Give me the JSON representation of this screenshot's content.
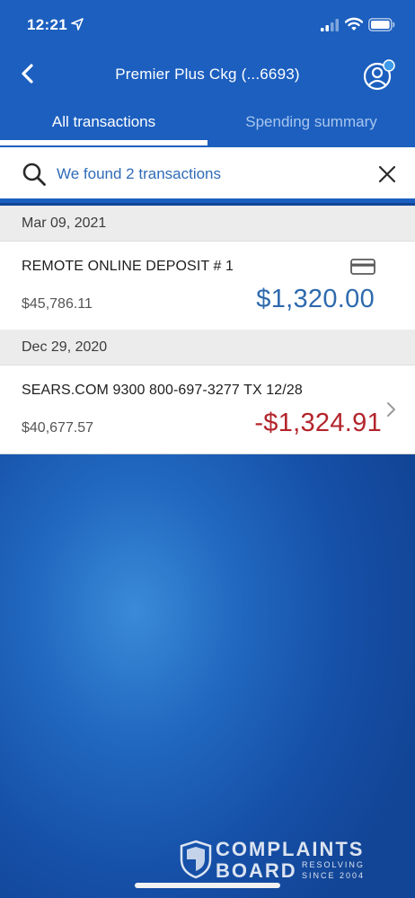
{
  "status": {
    "time": "12:21"
  },
  "nav": {
    "title": "Premier Plus Ckg  (...6693)"
  },
  "tabs": [
    {
      "label": "All transactions"
    },
    {
      "label": "Spending summary"
    }
  ],
  "search": {
    "result_text": "We found 2 transactions"
  },
  "groups": [
    {
      "date": "Mar 09, 2021",
      "transactions": [
        {
          "description": "REMOTE ONLINE DEPOSIT # 1",
          "balance": "$45,786.11",
          "amount": "$1,320.00",
          "type": "credit",
          "icon": "card-icon"
        }
      ]
    },
    {
      "date": "Dec 29, 2020",
      "transactions": [
        {
          "description": "SEARS.COM 9300 800-697-3277 TX 12/28",
          "balance": "$40,677.57",
          "amount": "-$1,324.91",
          "type": "debit",
          "icon": "chevron-right-icon"
        }
      ]
    }
  ],
  "watermark": {
    "line1": "COMPLAINTS",
    "line2": "BOARD",
    "tag1": "RESOLVING",
    "tag2": "SINCE 2004"
  },
  "colors": {
    "header_blue": "#1c5fbf",
    "credit_blue": "#2e6aae",
    "debit_red": "#b3242b",
    "notification_dot": "#3d9be9"
  }
}
